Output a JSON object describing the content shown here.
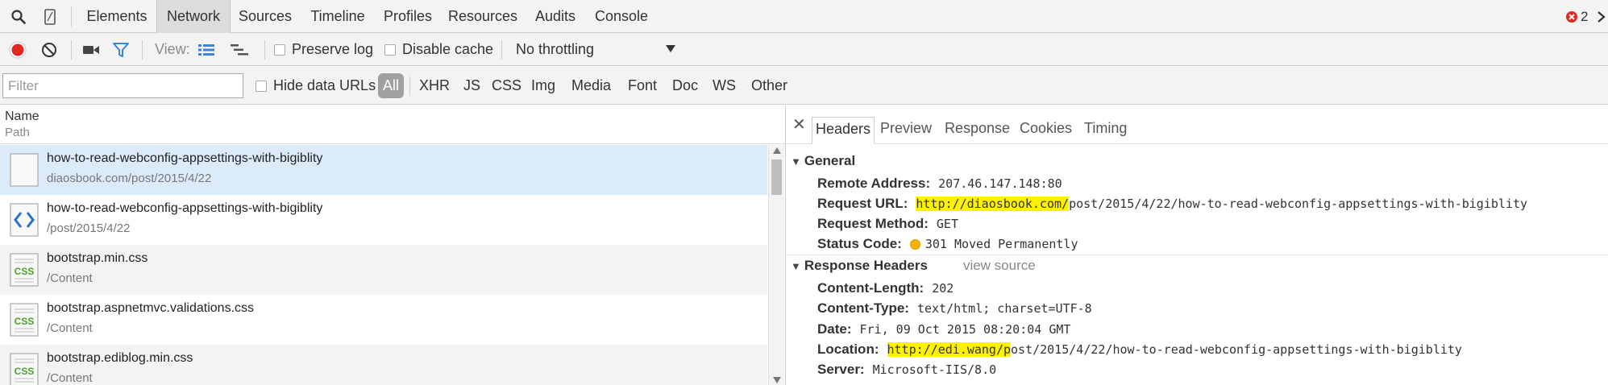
{
  "tabbar": {
    "tabs": [
      "Elements",
      "Network",
      "Sources",
      "Timeline",
      "Profiles",
      "Resources",
      "Audits",
      "Console"
    ],
    "active": "Network",
    "error_count": "2"
  },
  "toolbar": {
    "view_label": "View:",
    "preserve_log": "Preserve log",
    "disable_cache": "Disable cache",
    "throttling": "No throttling"
  },
  "filterbar": {
    "placeholder": "Filter",
    "hide_data_urls": "Hide data URLs",
    "types": [
      "All",
      "XHR",
      "JS",
      "CSS",
      "Img",
      "Media",
      "Font",
      "Doc",
      "WS",
      "Other"
    ]
  },
  "list": {
    "col_name": "Name",
    "col_path": "Path",
    "rows": [
      {
        "name": "how-to-read-webconfig-appsettings-with-bigiblity",
        "path": "diaosbook.com/post/2015/4/22",
        "icon": "document-icon"
      },
      {
        "name": "how-to-read-webconfig-appsettings-with-bigiblity",
        "path": "/post/2015/4/22",
        "icon": "html-file-icon"
      },
      {
        "name": "bootstrap.min.css",
        "path": "/Content",
        "icon": "css-file-icon",
        "icon_text": "CSS"
      },
      {
        "name": "bootstrap.aspnetmvc.validations.css",
        "path": "/Content",
        "icon": "css-file-icon",
        "icon_text": "CSS"
      },
      {
        "name": "bootstrap.ediblog.min.css",
        "path": "/Content",
        "icon": "css-file-icon",
        "icon_text": "CSS"
      }
    ]
  },
  "details": {
    "tabs": [
      "Headers",
      "Preview",
      "Response",
      "Cookies",
      "Timing"
    ],
    "active": "Headers",
    "general_title": "General",
    "general": {
      "remote_address_label": "Remote Address:",
      "remote_address": "207.46.147.148:80",
      "request_url_label": "Request URL:",
      "request_url_hl": "http://diaosbook.com/",
      "request_url_rest": "post/2015/4/22/how-to-read-webconfig-appsettings-with-bigiblity",
      "request_method_label": "Request Method:",
      "request_method": "GET",
      "status_code_label": "Status Code:",
      "status_code": "301 Moved Permanently"
    },
    "response_headers_title": "Response Headers",
    "view_source": "view source",
    "response": {
      "content_length_label": "Content-Length:",
      "content_length": "202",
      "content_type_label": "Content-Type:",
      "content_type": "text/html; charset=UTF-8",
      "date_label": "Date:",
      "date": "Fri, 09 Oct 2015 08:20:04 GMT",
      "location_label": "Location:",
      "location_hl": "http://edi.wang/p",
      "location_rest": "ost/2015/4/22/how-to-read-webconfig-appsettings-with-bigiblity",
      "server_label": "Server:",
      "server": "Microsoft-IIS/8.0"
    }
  },
  "colors": {
    "record_red": "#e0281f",
    "filter_blue": "#3b84d6",
    "highlight_yellow": "#fff200",
    "selected_row": "#dcebfa",
    "status_dot": "#f5b400"
  }
}
